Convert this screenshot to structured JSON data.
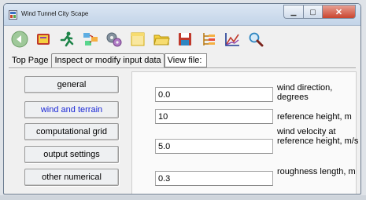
{
  "window": {
    "title": "Wind Tunnel City Scape",
    "minimize_label": "▁",
    "maximize_label": "▢",
    "close_label": "✕"
  },
  "toolbar": {
    "icons": [
      "back-icon",
      "book-icon",
      "runner-icon",
      "workflow-icon",
      "gears-icon",
      "window-icon",
      "folder-icon",
      "save-icon",
      "tree-icon",
      "chart-icon",
      "search-icon"
    ]
  },
  "tabs": {
    "top_page": "Top Page",
    "inspect": "Inspect or modify input data",
    "view_file": "View file:"
  },
  "nav": {
    "general": "general",
    "wind_and_terrain": "wind and terrain",
    "computational_grid": "computational grid",
    "output_settings": "output settings",
    "other_numerical": "other numerical"
  },
  "fields": {
    "wind_direction": {
      "value": "0.0",
      "label": "wind direction, degrees"
    },
    "reference_height": {
      "value": "10",
      "label": "reference height, m"
    },
    "wind_velocity": {
      "value": "5.0",
      "label": "wind velocity at reference height, m/s"
    },
    "roughness_length": {
      "value": "0.3",
      "label": "roughness length, m"
    }
  },
  "colors": {
    "active_nav": "#1a27d6"
  }
}
